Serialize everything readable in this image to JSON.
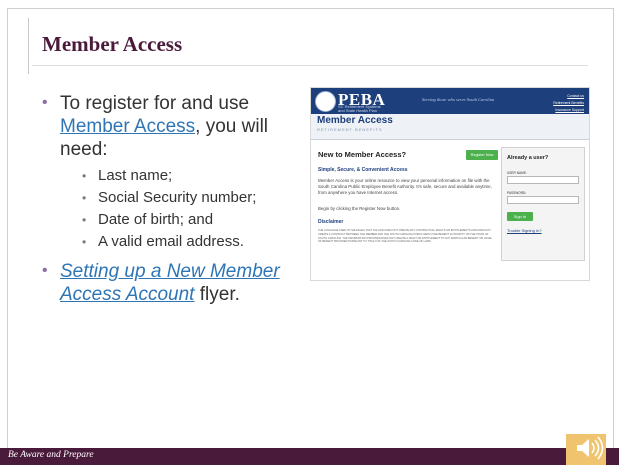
{
  "slide": {
    "title": "Member Access",
    "bullet1": {
      "lead": "To register for and use",
      "link": "Member Access",
      "trail": ", you will need:"
    },
    "sub_bullets": [
      "Last name;",
      "Social Security number;",
      "Date of birth; and",
      "A valid email address."
    ],
    "bullet2": {
      "link": "Setting up a New Member Access Account",
      "trail": " flyer."
    },
    "footer": "Be Aware and Prepare",
    "bullet_glyph": "•"
  },
  "screenshot": {
    "logo": "PEBA",
    "logo_sub1": "SC Retirement Systems",
    "logo_sub2": "and State Health Plan",
    "tagline": "Serving those who serve South Carolina",
    "links": [
      "Contact us",
      "Retirement Benefits",
      "Insurance Support"
    ],
    "page_title": "Member Access",
    "page_subtitle": "RETIREMENT BENEFITS",
    "new_title": "New to Member Access?",
    "register_button": "Register Now",
    "simple_heading": "Simple, Secure, & Convenient Access",
    "paragraph": "Member Access is your online resource to view your personal information on file with the South Carolina Public Employee Benefit Authority. It's safe, secure and available anytime, from anywhere you have Internet access.",
    "begin_text": "Begin by clicking the Register Now button.",
    "disclaimer_heading": "Disclaimer",
    "disclaimer_text": "THE LANGUAGE USED IN THE PAGES THAT FOLLOW DOES NOT CREATE ANY CONTRACTUAL RIGHTS OR ENTITLEMENTS AND DOES NOT CREATE A CONTRACT BETWEEN THE MEMBER AND THE SOUTH CAROLINA PUBLIC EMPLOYEE BENEFIT AUTHORITY OR THE STATE OF SOUTH CAROLINA. THE INFORMATION PROVIDED DOES NOT CREATE A RIGHT OR ENTITLEMENT TO ANY PARTICULAR BENEFIT OR LEVEL OF BENEFIT PROVIDED PURSUANT TO TITLE 9 OF THE SOUTH CAROLINA CODE OF LAWS.",
    "already_title": "Already a user?",
    "username_label": "USER NAME:",
    "password_label": "PASSWORD:",
    "signin_button": "Sign In",
    "trouble_link": "Trouble Signing In?"
  },
  "colors": {
    "title": "#4a1a3a",
    "footer_bg": "#4a1a3a",
    "link": "#2e75b6",
    "peba_blue": "#1d3f7c",
    "button_green": "#4cb04c",
    "speaker": "#f0c46f"
  },
  "icons": {
    "speaker": "speaker-icon"
  }
}
